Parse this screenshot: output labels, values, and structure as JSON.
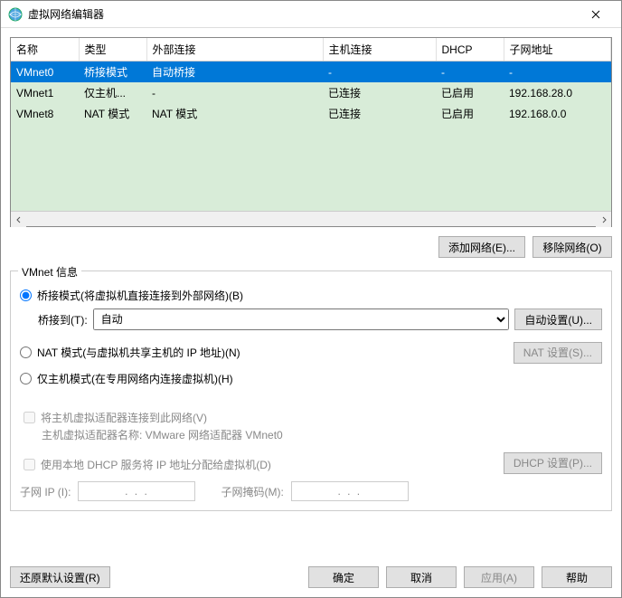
{
  "window": {
    "title": "虚拟网络编辑器"
  },
  "table": {
    "headers": [
      "名称",
      "类型",
      "外部连接",
      "主机连接",
      "DHCP",
      "子网地址"
    ],
    "rows": [
      {
        "name": "VMnet0",
        "type": "桥接模式",
        "ext": "自动桥接",
        "host": "-",
        "dhcp": "-",
        "subnet": "-",
        "selected": true
      },
      {
        "name": "VMnet1",
        "type": "仅主机...",
        "ext": "-",
        "host": "已连接",
        "dhcp": "已启用",
        "subnet": "192.168.28.0",
        "selected": false
      },
      {
        "name": "VMnet8",
        "type": "NAT 模式",
        "ext": "NAT 模式",
        "host": "已连接",
        "dhcp": "已启用",
        "subnet": "192.168.0.0",
        "selected": false
      }
    ]
  },
  "buttons": {
    "add_network": "添加网络(E)...",
    "remove_network": "移除网络(O)",
    "auto_settings": "自动设置(U)...",
    "nat_settings": "NAT 设置(S)...",
    "dhcp_settings": "DHCP 设置(P)...",
    "restore_defaults": "还原默认设置(R)",
    "ok": "确定",
    "cancel": "取消",
    "apply": "应用(A)",
    "help": "帮助"
  },
  "group": {
    "legend": "VMnet 信息",
    "radio_bridge": "桥接模式(将虚拟机直接连接到外部网络)(B)",
    "bridge_to_label": "桥接到(T):",
    "bridge_to_value": "自动",
    "radio_nat": "NAT 模式(与虚拟机共享主机的 IP 地址)(N)",
    "radio_hostonly": "仅主机模式(在专用网络内连接虚拟机)(H)",
    "check_host_adapter": "将主机虚拟适配器连接到此网络(V)",
    "adapter_name_label": "主机虚拟适配器名称: VMware 网络适配器 VMnet0",
    "check_dhcp": "使用本地 DHCP 服务将 IP 地址分配给虚拟机(D)",
    "subnet_ip_label": "子网 IP (I):",
    "subnet_mask_label": "子网掩码(M):",
    "ip_placeholder": ".       .       ."
  }
}
